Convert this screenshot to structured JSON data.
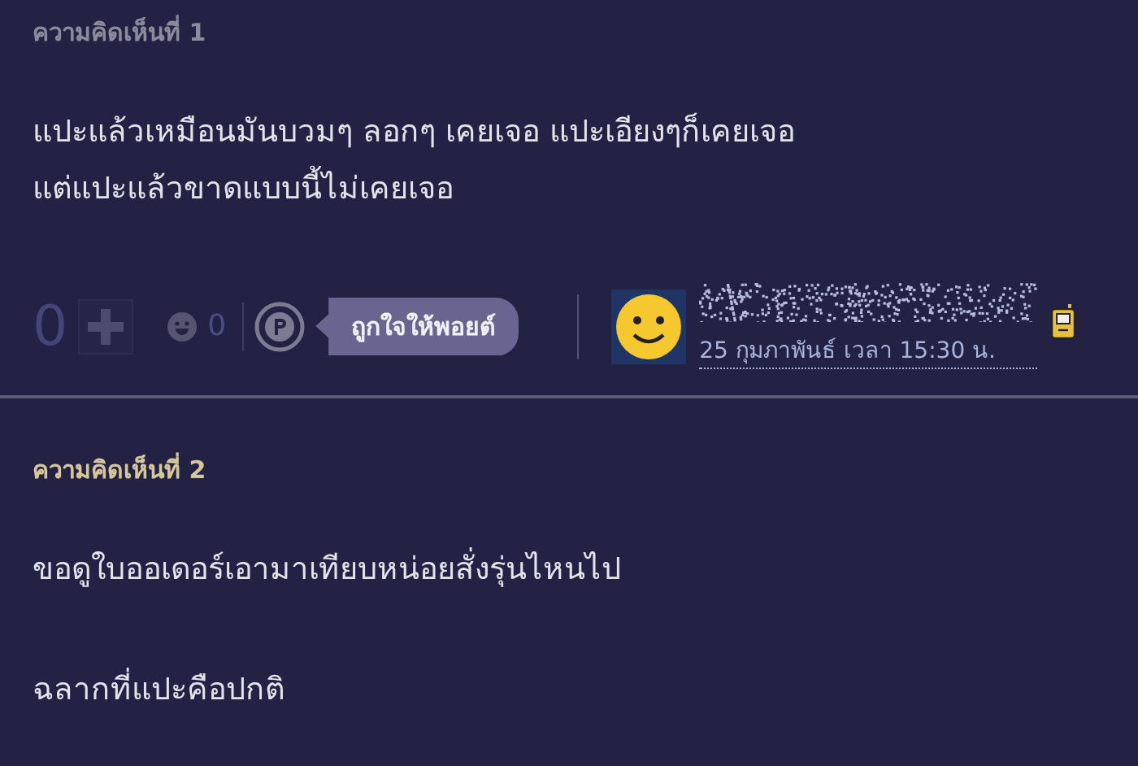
{
  "comments": [
    {
      "header": "ความคิดเห็นที่ 1",
      "color": "#8c8b9c",
      "paragraphs": [
        [
          "แปะแล้วเหมือนมันบวมๆ ลอกๆ เคยเจอ แปะเอียงๆก็เคยเจอ",
          "แต่แปะแล้วขาดแบบนี้ไม่เคยเจอ"
        ]
      ],
      "actions": {
        "votes": "0",
        "emotions": "0",
        "point_tooltip": "ถูกใจให้พอยต์"
      },
      "author": {
        "date": "25 กุมภาพันธ์ เวลา 15:30 น."
      }
    },
    {
      "header": "ความคิดเห็นที่ 2",
      "color": "#d6c79a",
      "paragraphs": [
        [
          "ขอดูใบออเดอร์เอามาเทียบหน่อยสั่งรุ่นไหนไป"
        ],
        [
          "ฉลากที่แปะคือปกติ"
        ]
      ]
    }
  ]
}
